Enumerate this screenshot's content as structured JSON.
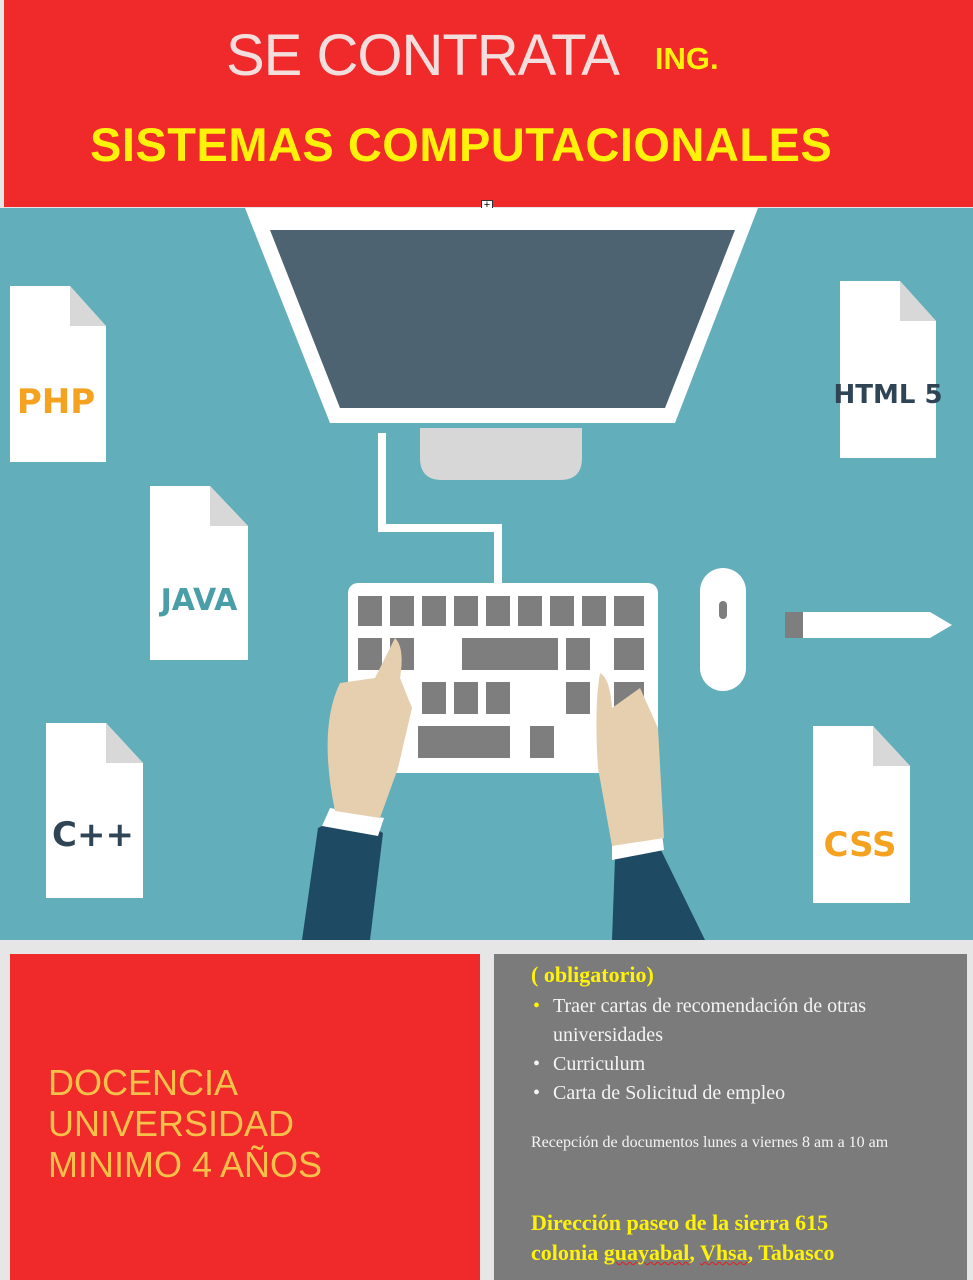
{
  "header": {
    "line1_main": "SE CONTRATA",
    "line1_suffix": "ING.",
    "line2": "SISTEMAS COMPUTACIONALES"
  },
  "illustration": {
    "file_labels": [
      "PHP",
      "JAVA",
      "C++",
      "HTML 5",
      "CSS"
    ]
  },
  "left_panel": {
    "lines": [
      "DOCENCIA",
      "UNIVERSIDAD",
      "MINIMO 4 AÑOS"
    ]
  },
  "right_panel": {
    "mandatory_label": "( obligatorio)",
    "requirements": [
      "Traer  cartas de recomendación de otras  universidades",
      "Curriculum",
      "Carta de Solicitud de empleo"
    ],
    "reception": "Recepción de documentos lunes a viernes 8 am a 10 am",
    "address_line1": "Dirección paseo de la sierra 615",
    "address_line2_a": "colonia ",
    "address_line2_b": "guayabal",
    "address_line2_c": ",  ",
    "address_line2_d": "Vhsa",
    "address_line2_e": ", Tabasco"
  },
  "colors": {
    "header_red": "#f02a2a",
    "accent_yellow": "#fff20a",
    "illustration_teal": "#62aeba",
    "panel_gray": "#7b7b7b"
  }
}
